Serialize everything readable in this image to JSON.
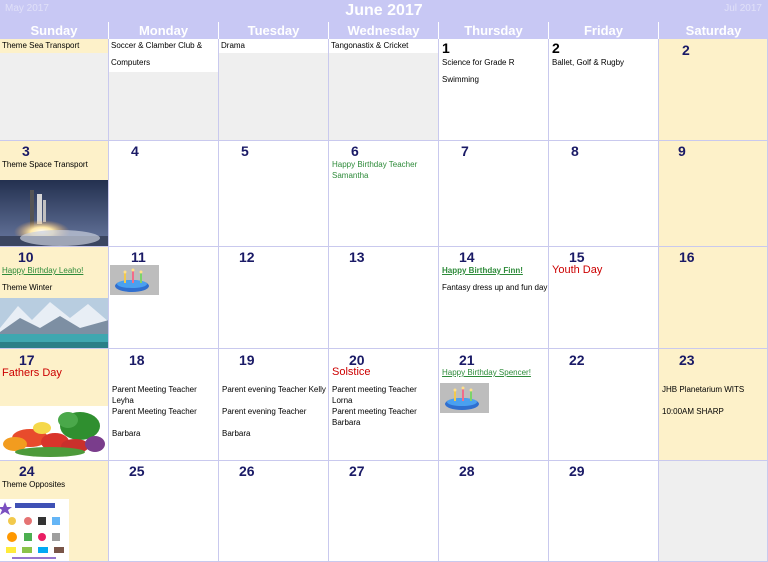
{
  "header": {
    "title": "June 2017",
    "prev_label": "May 2017",
    "next_label": "Jul 2017"
  },
  "days_of_week": [
    "Sunday",
    "Monday",
    "Tuesday",
    "Wednesday",
    "Thursday",
    "Friday",
    "Saturday"
  ],
  "colors": {
    "header_bg": "#c8c8f4",
    "weekend_bg": "#fdf1c9",
    "grid_line": "#c9c9ee",
    "day_number": "#1a1a66",
    "holiday_red": "#cc0000",
    "birthday_green": "#2e8b3a"
  },
  "week0": {
    "sun": "Theme Sea Transport",
    "mon": "Soccer & Clamber Club &",
    "mon2": "Computers",
    "tue": "Drama",
    "wed": "Tangonastix & Cricket",
    "thu_num": "1",
    "thu1": "Science for Grade R",
    "thu2": "Swimming",
    "fri_num": "2",
    "fri1": "Ballet, Golf & Rugby",
    "sat_num": "2"
  },
  "week1": {
    "sun_num": "3",
    "sun_text": "Theme Space Transport",
    "sun_image": "space-shuttle-launch",
    "mon_num": "4",
    "tue_num": "5",
    "wed_num": "6",
    "wed_text": "Happy Birthday Teacher Samantha",
    "thu_num": "7",
    "fri_num": "8",
    "sat_num": "9"
  },
  "week2": {
    "sun_num": "10",
    "sun_bday": "Happy Birthday Leaho!",
    "sun_text": "Theme Winter",
    "sun_image": "snowy-mountain-lake",
    "mon_num": "11",
    "mon_image": "birthday-cake",
    "tue_num": "12",
    "wed_num": "13",
    "thu_num": "14",
    "thu_bday": "Happy Birthday Finn!",
    "thu_text": "Fantasy dress up and fun day",
    "fri_num": "15",
    "fri_holiday": "Youth Day",
    "sat_num": "16"
  },
  "week3": {
    "sun_num": "17",
    "sun_holiday": "Fathers Day",
    "sun_image": "vegetables",
    "mon_num": "18",
    "mon_text1": "Parent Meeting Teacher Leyha",
    "mon_text2": "Parent Meeting Teacher",
    "mon_text3": "Barbara",
    "tue_num": "19",
    "tue_text1": "Parent evening Teacher Kelly",
    "tue_text2": "Parent evening Teacher",
    "tue_text3": "Barbara",
    "wed_num": "20",
    "wed_holiday": "Solstice",
    "wed_text1": "Parent meeting Teacher Lorna",
    "wed_text2": "Parent meeting Teacher Barbara",
    "thu_num": "21",
    "thu_bday": "Happy Birthday Spencer!",
    "thu_image": "birthday-cake",
    "fri_num": "22",
    "sat_num": "23",
    "sat_text1": "JHB Planetarium WITS",
    "sat_text2": "10:00AM SHARP"
  },
  "week4": {
    "sun_num": "24",
    "sun_text": "Theme Opposites",
    "sun_image": "list-of-opposites",
    "mon_num": "25",
    "tue_num": "26",
    "wed_num": "27",
    "thu_num": "28",
    "fri_num": "29"
  }
}
